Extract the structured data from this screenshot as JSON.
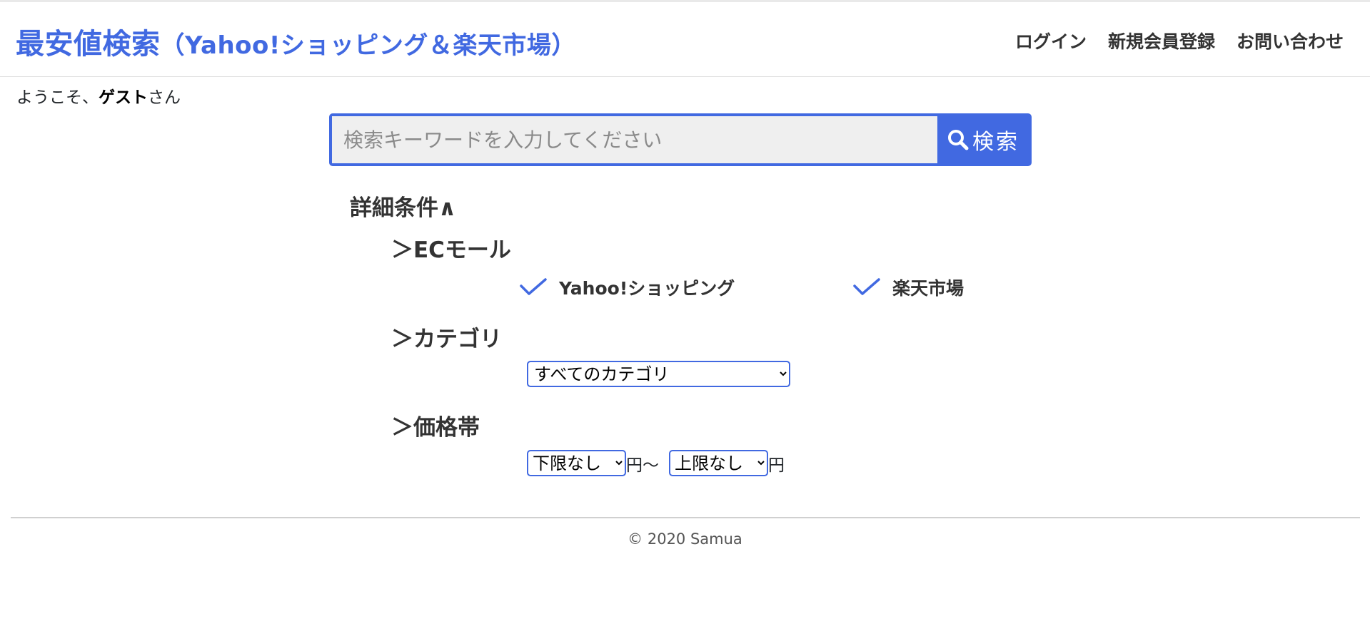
{
  "header": {
    "brand_main": "最安値検索",
    "brand_sub": "（Yahoo!ショッピング＆楽天市場）",
    "nav": {
      "login": "ログイン",
      "register": "新規会員登録",
      "contact": "お問い合わせ"
    }
  },
  "welcome": {
    "prefix": "ようこそ、",
    "name": "ゲスト",
    "suffix": "さん"
  },
  "search": {
    "placeholder": "検索キーワードを入力してください",
    "value": "",
    "button_label": "検索",
    "button_icon": "search-icon"
  },
  "detail": {
    "toggle_label": "詳細条件∧",
    "ec_mall": {
      "title": "＞ECモール",
      "options": [
        {
          "label": "Yahoo!ショッピング",
          "checked": true
        },
        {
          "label": "楽天市場",
          "checked": true
        }
      ]
    },
    "category": {
      "title": "＞カテゴリ",
      "selected": "すべてのカテゴリ"
    },
    "price": {
      "title": "＞価格帯",
      "min_selected": "下限なし",
      "min_unit": "円〜",
      "max_selected": "上限なし",
      "max_unit": "円"
    }
  },
  "footer": {
    "copyright": "© 2020 Samua"
  },
  "colors": {
    "accent": "#4169e1",
    "input_bg": "#efefef",
    "text": "#333333"
  }
}
